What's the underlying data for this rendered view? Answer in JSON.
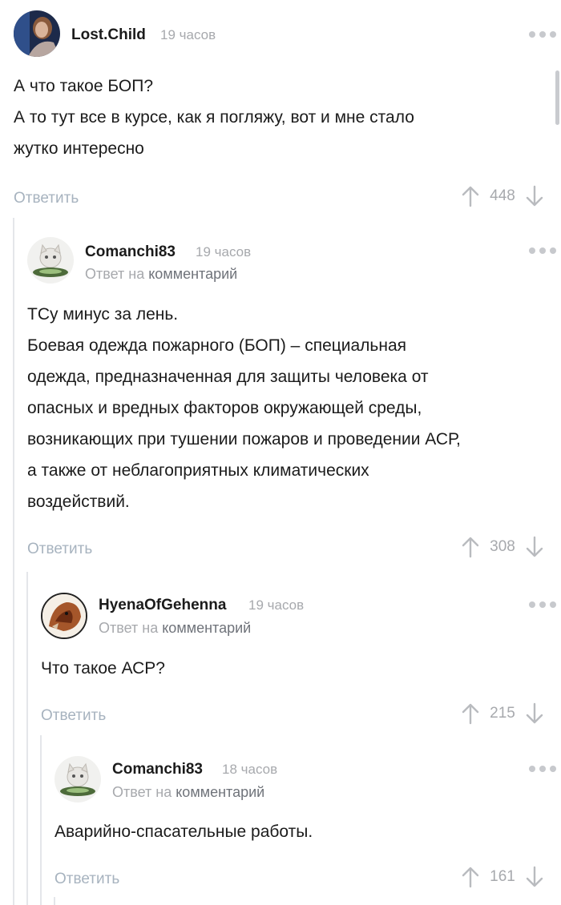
{
  "comments": [
    {
      "username": "Lost.Child",
      "time": "19 часов",
      "lines": [
        "А что такое БОП?",
        "А то тут все в курсе, как я погляжу, вот и  мне стало",
        "жутко интересно"
      ],
      "reply_label": "Ответить",
      "rating": "448"
    },
    {
      "username": "Comanchi83",
      "time": "19 часов",
      "reply_to_prefix": "Ответ на",
      "reply_to_link": "комментарий",
      "lines": [
        "ТСу минус за лень.",
        "Боевая одежда пожарного (БОП) – специальная",
        "одежда, предназначенная для защиты человека от",
        "опасных и вредных факторов окружающей среды,",
        "возникающих при тушении пожаров и проведении АСР,",
        "а также от неблагоприятных климатических",
        "воздействий."
      ],
      "reply_label": "Ответить",
      "rating": "308"
    },
    {
      "username": "HyenaOfGehenna",
      "time": "19 часов",
      "reply_to_prefix": "Ответ на",
      "reply_to_link": "комментарий",
      "lines": [
        "Что такое АСР?"
      ],
      "reply_label": "Ответить",
      "rating": "215"
    },
    {
      "username": "Comanchi83",
      "time": "18 часов",
      "reply_to_prefix": "Ответ на",
      "reply_to_link": "комментарий",
      "lines": [
        "Аварийно-спасательные работы."
      ],
      "reply_label": "Ответить",
      "rating": "161"
    }
  ],
  "icons": {
    "upvote": "arrow-up-icon",
    "downvote": "arrow-down-icon",
    "more": "more-dots-icon"
  },
  "colors": {
    "text": "#1b1b1b",
    "muted": "#a7a9ad",
    "reply_link": "#a7b3bf",
    "thread_line": "#e4e6ea"
  }
}
